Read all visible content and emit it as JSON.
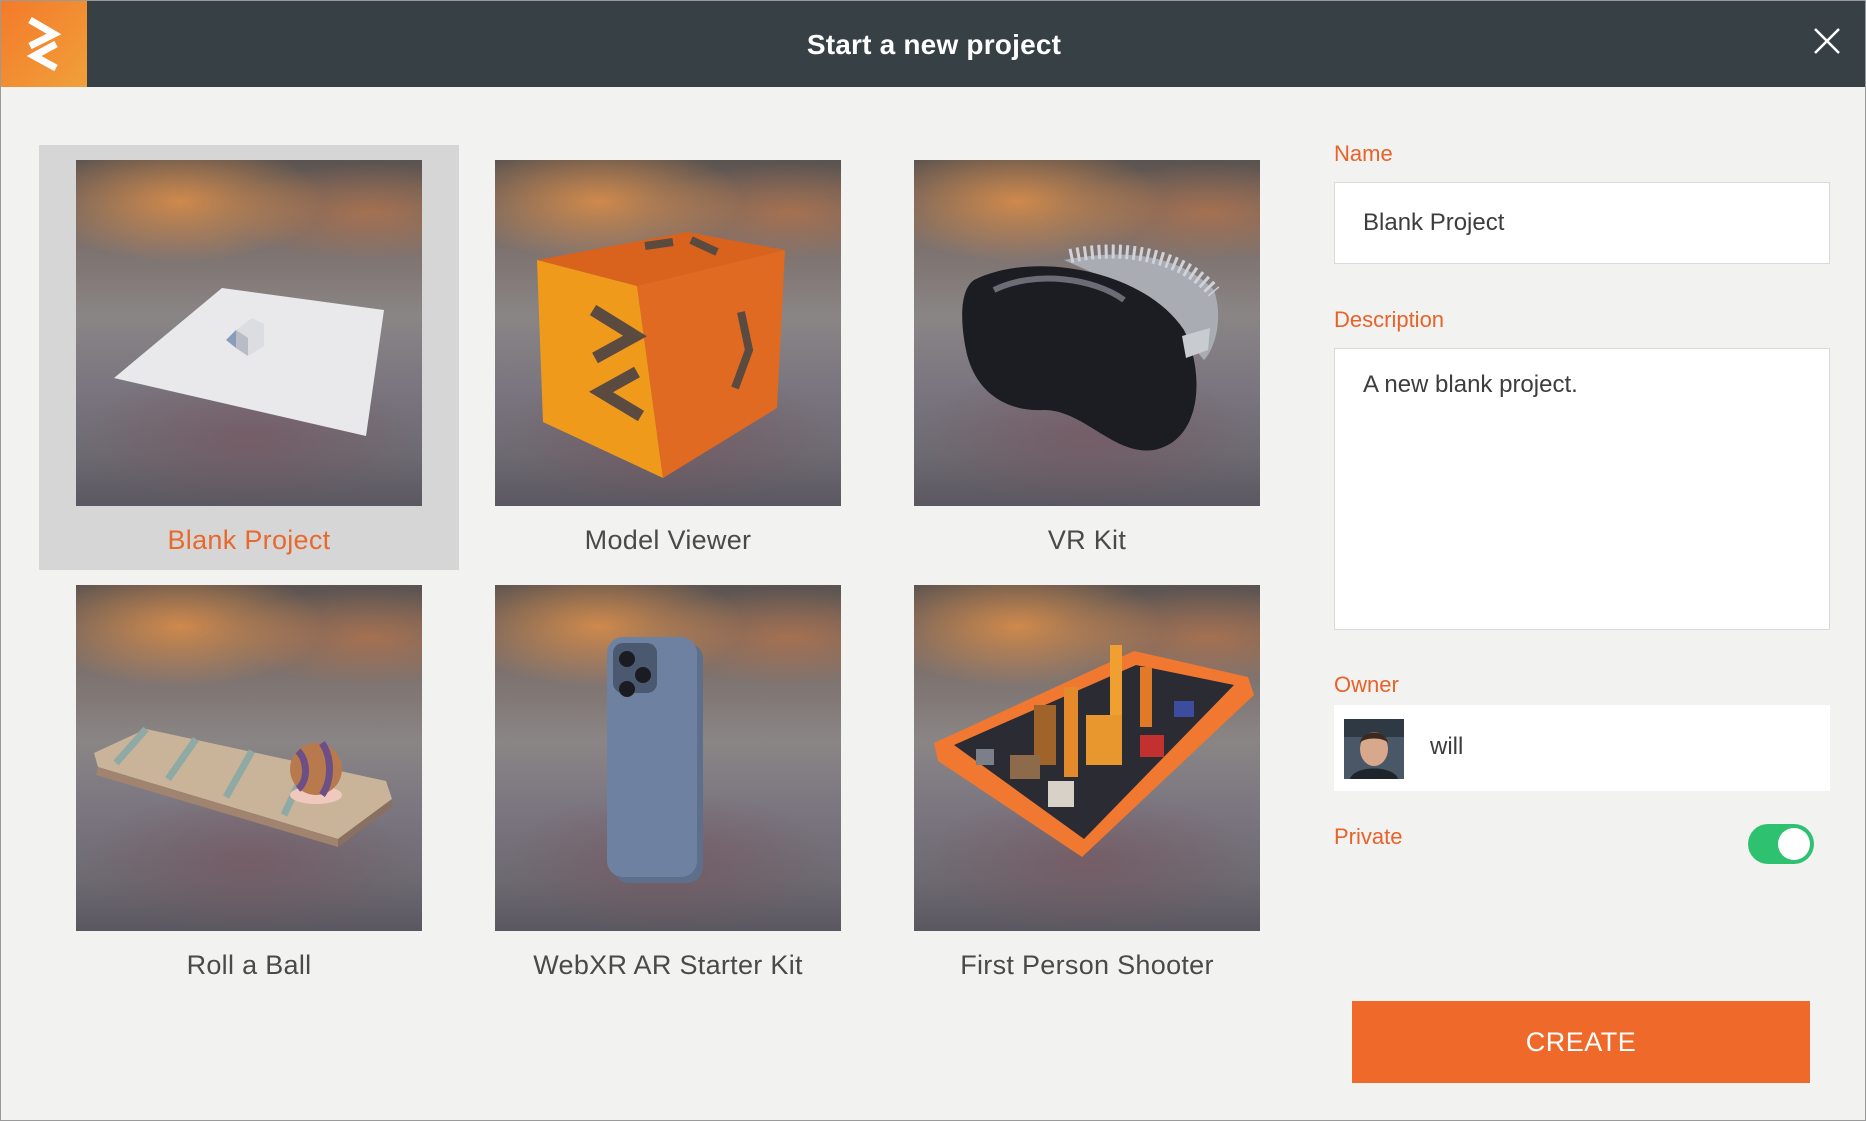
{
  "dialog": {
    "title": "Start a new project",
    "accent_color": "#ef6a2a"
  },
  "templates": [
    {
      "label": "Blank Project",
      "selected": true,
      "icon": "blank-plane-icon"
    },
    {
      "label": "Model Viewer",
      "selected": false,
      "icon": "orange-cube-icon"
    },
    {
      "label": "VR Kit",
      "selected": false,
      "icon": "vr-headset-icon"
    },
    {
      "label": "Roll a Ball",
      "selected": false,
      "icon": "ball-track-icon"
    },
    {
      "label": "WebXR AR Starter Kit",
      "selected": false,
      "icon": "phone-icon"
    },
    {
      "label": "First Person Shooter",
      "selected": false,
      "icon": "city-arena-icon"
    }
  ],
  "form": {
    "name_label": "Name",
    "name_value": "Blank Project",
    "description_label": "Description",
    "description_value": "A new blank project.",
    "owner_label": "Owner",
    "owner_name": "will",
    "private_label": "Private",
    "private_on": true,
    "create_label": "CREATE"
  }
}
